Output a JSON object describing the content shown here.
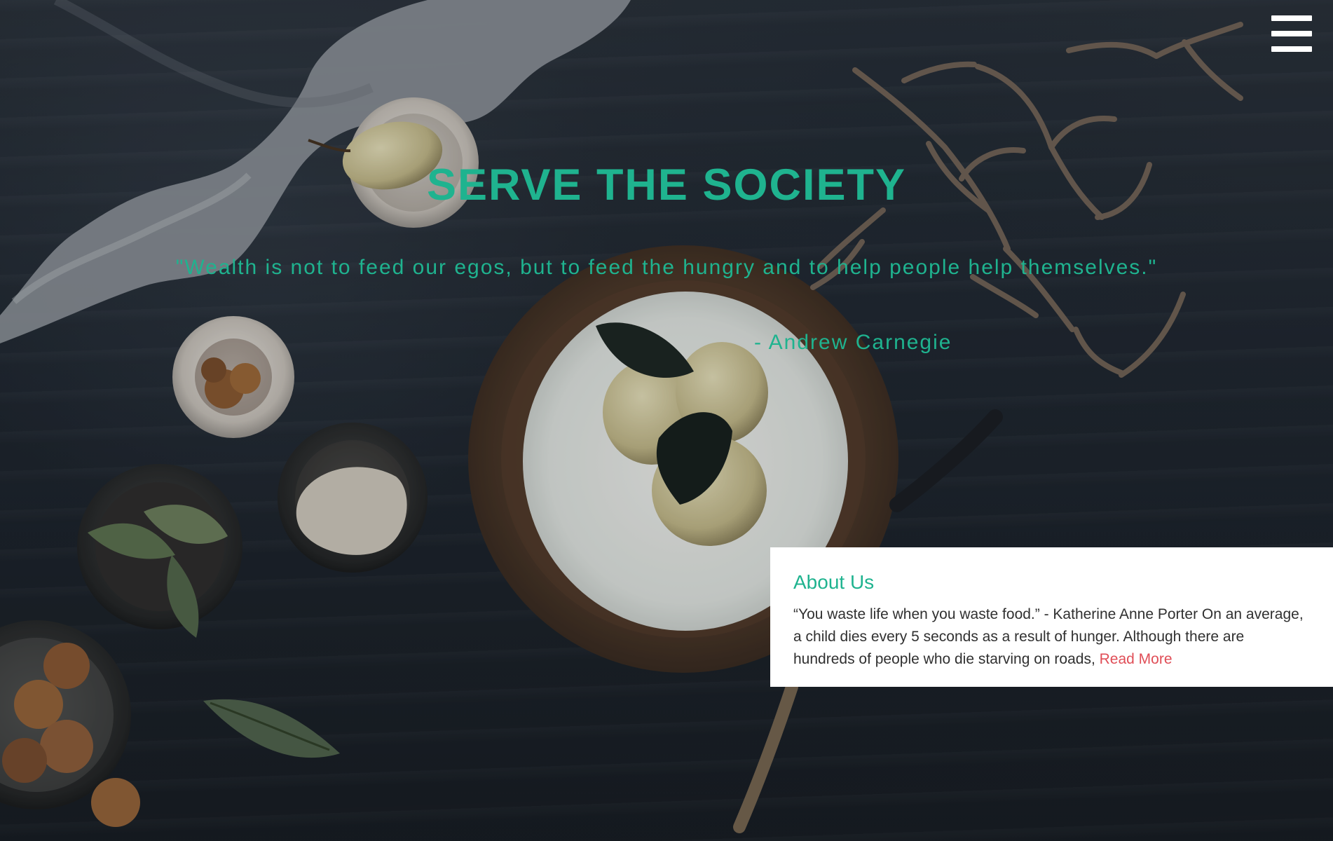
{
  "header": {
    "menu_icon": "hamburger-menu-icon"
  },
  "hero": {
    "title": "SERVE THE SOCIETY",
    "quote": "\"Wealth is not to feed our egos, but to feed the hungry and to help people help themselves.\"",
    "author": "- Andrew Carnegie"
  },
  "about": {
    "title": "About Us",
    "text": "“You waste life when you waste food.” - Katherine Anne Porter On an average, a child dies every 5 seconds as a result of hunger. Although there are hundreds of people who die starving on roads, ",
    "read_more": "Read More"
  },
  "colors": {
    "accent": "#1fb38f",
    "link": "#e04e57",
    "card_bg": "#ffffff",
    "text": "#303030"
  }
}
